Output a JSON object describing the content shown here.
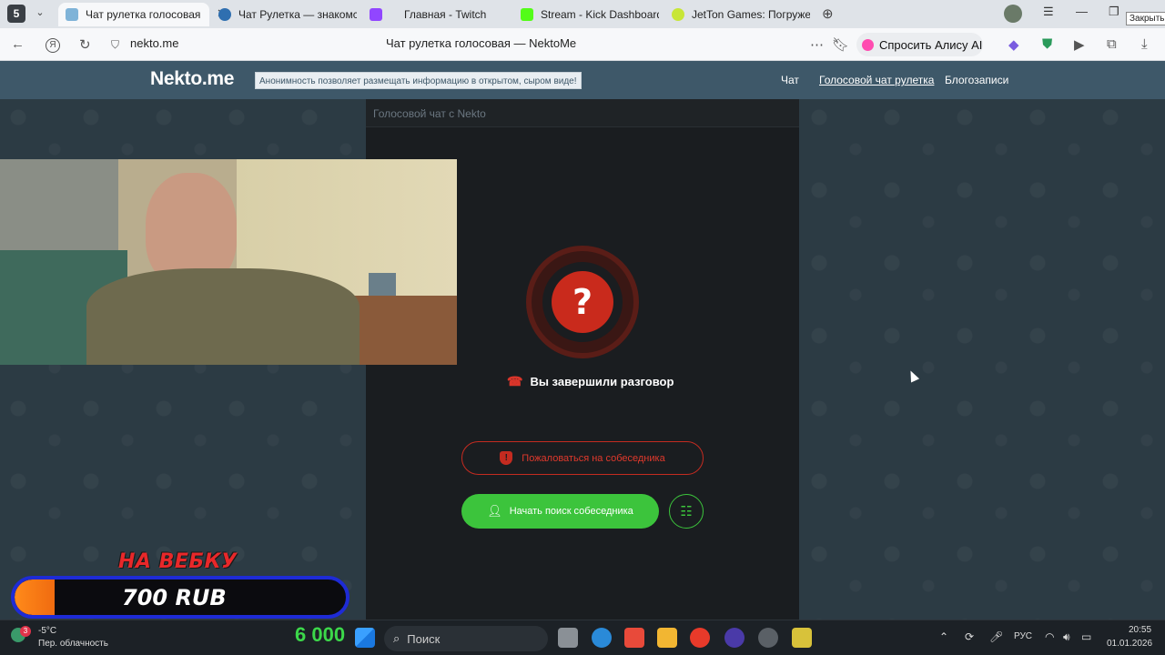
{
  "browser": {
    "tab_counter": "5",
    "tabs": [
      {
        "label": "Чат рулетка голосовая",
        "active": true
      },
      {
        "label": "Чат Рулетка — знакомств",
        "active": false
      },
      {
        "label": "Главная - Twitch",
        "active": false
      },
      {
        "label": "Stream - Kick Dashboard",
        "active": false
      },
      {
        "label": "JetTon Games: Погружен",
        "active": false
      }
    ],
    "url": "nekto.me",
    "page_title": "Чат рулетка голосовая — NektoMe",
    "alice_button": "Спросить Алису AI",
    "extension_badge": "5",
    "close_tooltip": "Закрыть"
  },
  "site": {
    "logo": "Nekto.me",
    "slogan": "Анонимность позволяет размещать информацию в открытом, сыром виде!",
    "nav": [
      "Чат",
      "Голосовой чат рулетка",
      "Блогозаписи"
    ]
  },
  "chat": {
    "panel_title": "Голосовой чат с Nekto",
    "status_icon": "?",
    "status_text": "Вы завершили разговор",
    "report_button": "Пожаловаться на собеседника",
    "start_button": "Начать поиск собеседника"
  },
  "overlay": {
    "donation_title": "НА ВЕБКУ",
    "donation_amount": "700 RUB",
    "donation_progress": 0.12,
    "counter": "6 000"
  },
  "taskbar": {
    "weather_badge": "3",
    "weather_temp": "-5°C",
    "weather_desc": "Пер. облачность",
    "search_label": "Поиск",
    "language": "РУС",
    "time": "20:55",
    "date": "01.01.2026"
  },
  "colors": {
    "accent_green": "#3cc43c",
    "alert_red": "#c92a1c",
    "header_blue": "#3e5869"
  }
}
